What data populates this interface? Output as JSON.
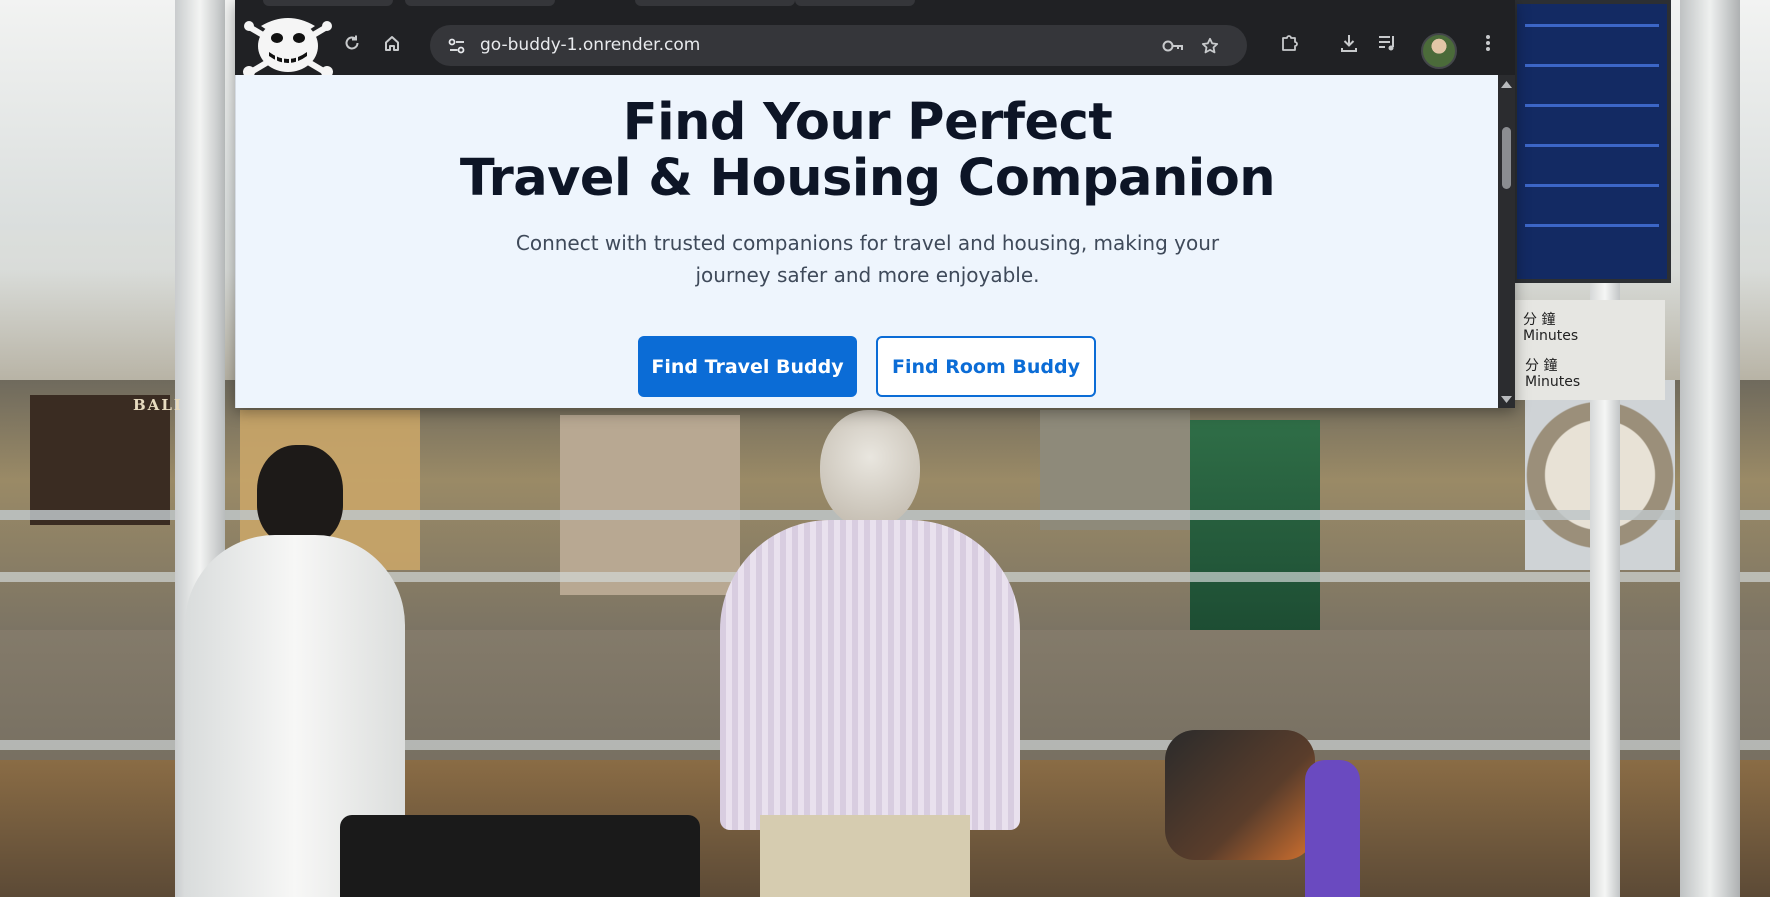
{
  "browser": {
    "url": "go-buddy-1.onrender.com",
    "icons": {
      "logo": "jolly-roger-skull-logo",
      "reload": "reload-icon",
      "home": "home-icon",
      "site_info": "site-info-icon",
      "password": "key-icon",
      "bookmark": "star-icon",
      "extensions": "puzzle-icon",
      "downloads": "download-icon",
      "media": "media-controls-icon",
      "menu": "kebab-menu-icon"
    }
  },
  "hero": {
    "title_line1": "Find Your Perfect",
    "title_line2": "Travel & Housing Companion",
    "subtitle_line1": "Connect with trusted companions for travel and housing, making your",
    "subtitle_line2": "journey safer and more enjoyable."
  },
  "actions": {
    "primary": "Find Travel Buddy",
    "secondary": "Find Room Buddy"
  },
  "background": {
    "store_sign": "BALI",
    "board_sign_cn_1": "分 鐘",
    "board_sign_en_1": "Minutes",
    "board_sign_cn_2": "分 鐘",
    "board_sign_en_2": "Minutes"
  },
  "colors": {
    "primary": "#0b6cd6",
    "page_bg": "#eef5fd",
    "title": "#0d1526",
    "chrome": "#202124"
  }
}
